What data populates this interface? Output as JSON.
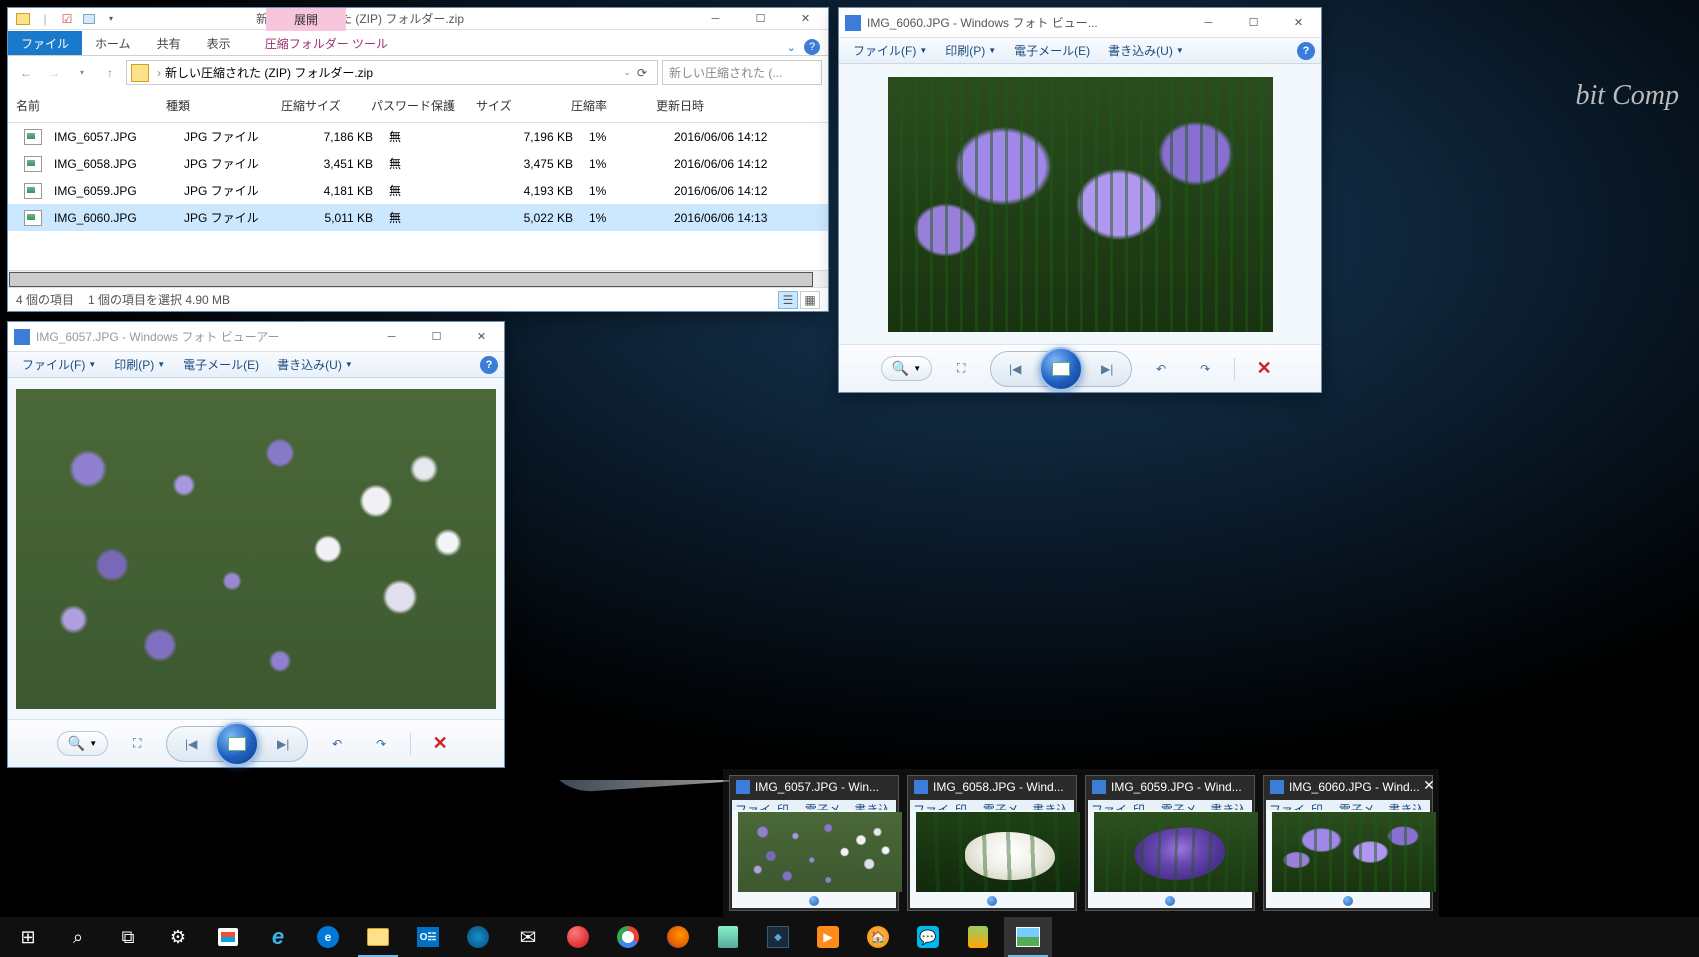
{
  "desktop": {
    "bg_text": "bit Comp"
  },
  "explorer": {
    "title": "新しい圧縮された (ZIP) フォルダー.zip",
    "context_group": "展開",
    "tabs": {
      "file": "ファイル",
      "home": "ホーム",
      "share": "共有",
      "view": "表示",
      "context": "圧縮フォルダー ツール"
    },
    "breadcrumb": "新しい圧縮された (ZIP) フォルダー.zip",
    "search_placeholder": "新しい圧縮された (...",
    "columns": {
      "name": "名前",
      "type": "種類",
      "csize": "圧縮サイズ",
      "pw": "パスワード保護",
      "size": "サイズ",
      "ratio": "圧縮率",
      "date": "更新日時"
    },
    "rows": [
      {
        "name": "IMG_6057.JPG",
        "type": "JPG ファイル",
        "csize": "7,186 KB",
        "pw": "無",
        "size": "7,196 KB",
        "ratio": "1%",
        "date": "2016/06/06 14:12",
        "sel": false
      },
      {
        "name": "IMG_6058.JPG",
        "type": "JPG ファイル",
        "csize": "3,451 KB",
        "pw": "無",
        "size": "3,475 KB",
        "ratio": "1%",
        "date": "2016/06/06 14:12",
        "sel": false
      },
      {
        "name": "IMG_6059.JPG",
        "type": "JPG ファイル",
        "csize": "4,181 KB",
        "pw": "無",
        "size": "4,193 KB",
        "ratio": "1%",
        "date": "2016/06/06 14:12",
        "sel": false
      },
      {
        "name": "IMG_6060.JPG",
        "type": "JPG ファイル",
        "csize": "5,011 KB",
        "pw": "無",
        "size": "5,022 KB",
        "ratio": "1%",
        "date": "2016/06/06 14:13",
        "sel": true
      }
    ],
    "status": {
      "count": "4 個の項目",
      "selection": "1 個の項目を選択 4.90 MB"
    }
  },
  "pv_menu": {
    "file": "ファイル(F)",
    "print": "印刷(P)",
    "email": "電子メール(E)",
    "write": "書き込み(U)"
  },
  "pv1": {
    "title": "IMG_6060.JPG - Windows フォト ビュー..."
  },
  "pv2": {
    "title": "IMG_6057.JPG - Windows フォト ビューアー"
  },
  "thumbs": [
    {
      "title": "IMG_6057.JPG - Win...",
      "img": "field"
    },
    {
      "title": "IMG_6058.JPG - Wind...",
      "img": "white-close"
    },
    {
      "title": "IMG_6059.JPG - Wind...",
      "img": "purple-close"
    },
    {
      "title": "IMG_6060.JPG - Wind...",
      "img": "multi"
    }
  ],
  "thumb_menu": [
    "ファイル(F)",
    "印刷(P)",
    "電子メール(E)",
    "書き込み(U)"
  ]
}
